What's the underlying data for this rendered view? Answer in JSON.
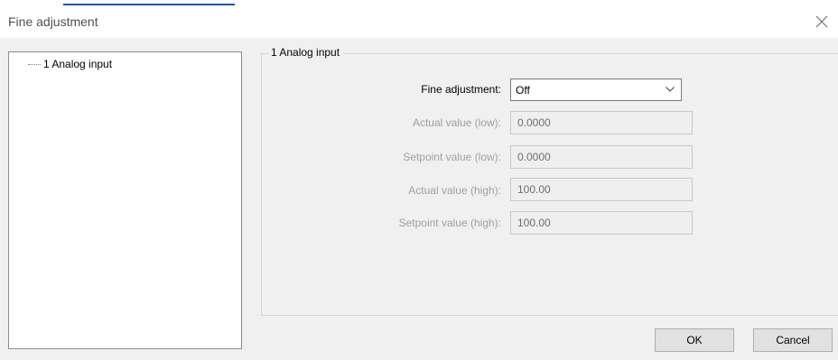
{
  "window": {
    "title": "Fine adjustment",
    "close_icon": "close-icon"
  },
  "tree": {
    "items": [
      {
        "label": "1 Analog input",
        "selected": true
      }
    ]
  },
  "group": {
    "title": "1 Analog input"
  },
  "fields": {
    "fine_adjustment": {
      "label": "Fine adjustment:",
      "value": "Off",
      "options": [
        "Off"
      ]
    },
    "actual_low": {
      "label": "Actual value (low):",
      "value": "0.0000"
    },
    "setpoint_low": {
      "label": "Setpoint value (low):",
      "value": "0.0000"
    },
    "actual_high": {
      "label": "Actual value (high):",
      "value": "100.00"
    },
    "setpoint_high": {
      "label": "Setpoint value (high):",
      "value": "100.00"
    }
  },
  "buttons": {
    "ok": "OK",
    "cancel": "Cancel"
  },
  "colors": {
    "disabled_text": "#a0a0a0",
    "field_disabled_bg": "#efefef",
    "dialog_bg": "#f0f0f0"
  }
}
